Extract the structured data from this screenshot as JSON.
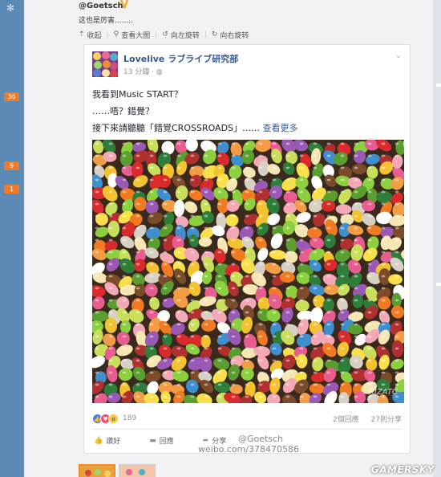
{
  "sidebar": {
    "badges": [
      "36",
      "9",
      "1"
    ]
  },
  "post": {
    "author": "@Goetsch",
    "text": "这也是厉害........",
    "toolbar": [
      {
        "icon": "collapse-icon",
        "label": "收起"
      },
      {
        "icon": "search-icon",
        "label": "查看大图"
      },
      {
        "icon": "rotate-left-icon",
        "label": "向左旋转"
      },
      {
        "icon": "rotate-right-icon",
        "label": "向右旋转"
      }
    ]
  },
  "card": {
    "page_name": "Lovelive ラブライブ研究部",
    "time": "13 分鐘 · ",
    "body_lines": [
      "我看到Music START？",
      "……唔？錯覺？"
    ],
    "body_line3": "接下來請聽聽「錯覚CROSSROADS」……",
    "see_more": "查看更多",
    "reaction_count": "189",
    "comments": "2個回應",
    "shares": "27則分享",
    "actions": [
      {
        "icon": "like-icon",
        "label": "讚好"
      },
      {
        "icon": "comment-icon",
        "label": "回應"
      },
      {
        "icon": "share-icon",
        "label": "分享"
      }
    ],
    "photo_watermark": "RIZATC"
  },
  "overlay": {
    "weibo_user": "@Goetsch",
    "weibo_url": "weibo.com/378470586",
    "site": "GAMERSKY"
  },
  "colors": {
    "sidebar": "#5b8bb5",
    "badge": "#ef7b2a",
    "link": "#365899"
  }
}
